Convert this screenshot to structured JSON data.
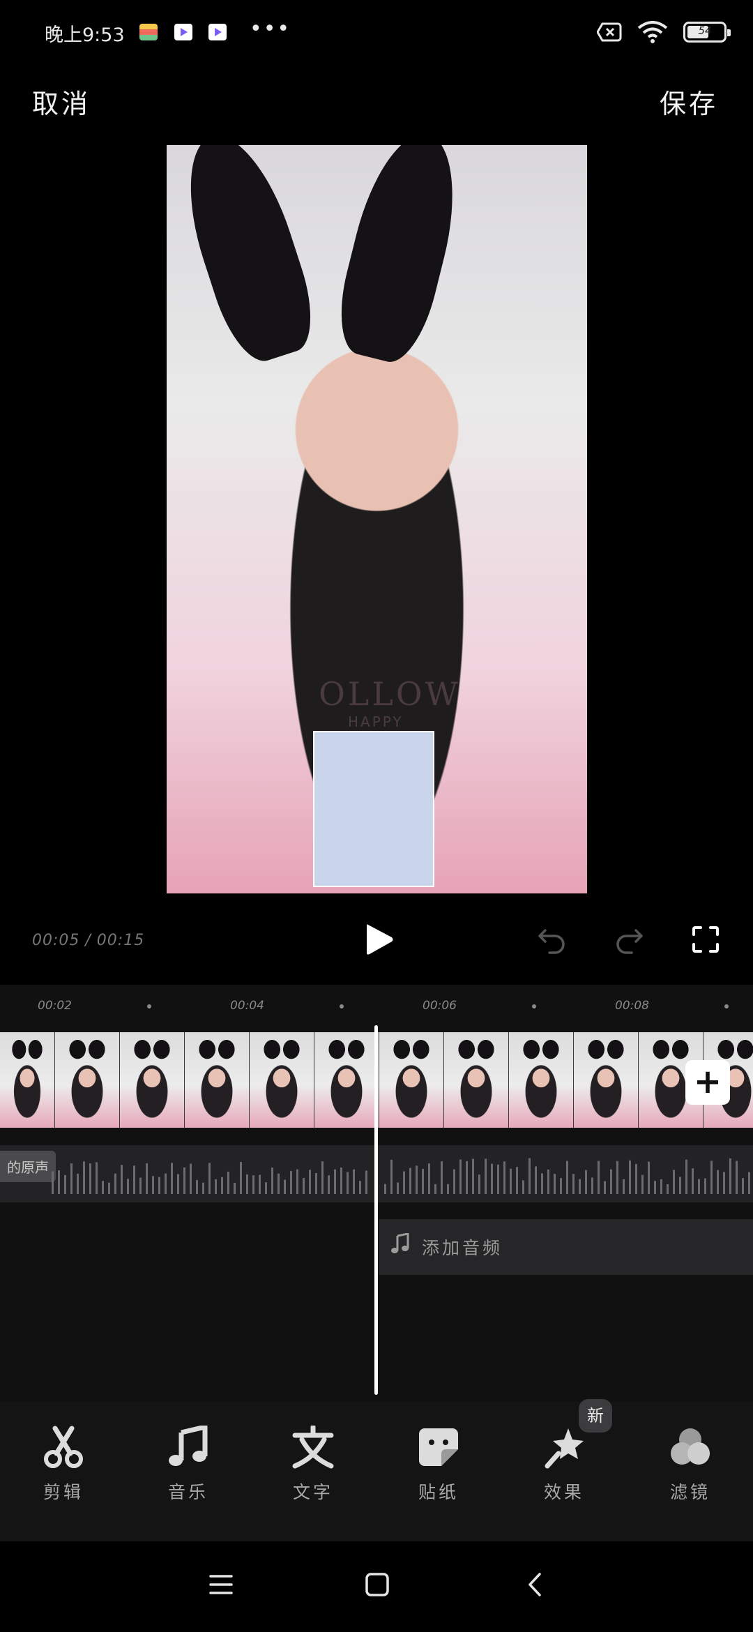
{
  "status_bar": {
    "time": "晚上9:53",
    "battery": "54",
    "more": "•••"
  },
  "header": {
    "cancel": "取消",
    "save": "保存"
  },
  "preview": {
    "shirt_text": "OLLOW",
    "shirt_sub": "HAPPY"
  },
  "player": {
    "timecode": "00:05 / 00:15"
  },
  "timeline": {
    "ticks": [
      "00:02",
      "00:04",
      "00:06",
      "00:08"
    ],
    "original_audio_label": "的原声",
    "add_audio": "添加音频"
  },
  "toolbar": {
    "items": [
      {
        "label": "剪辑",
        "icon": "scissors-icon"
      },
      {
        "label": "音乐",
        "icon": "music-note-icon"
      },
      {
        "label": "文字",
        "icon": "text-icon"
      },
      {
        "label": "贴纸",
        "icon": "sticker-icon"
      },
      {
        "label": "效果",
        "icon": "magic-star-icon"
      },
      {
        "label": "滤镜",
        "icon": "filter-circles-icon"
      }
    ],
    "badge_new": "新"
  },
  "colors": {
    "background": "#000000",
    "timeline_bg": "#111112",
    "accent_white": "#ffffff"
  }
}
